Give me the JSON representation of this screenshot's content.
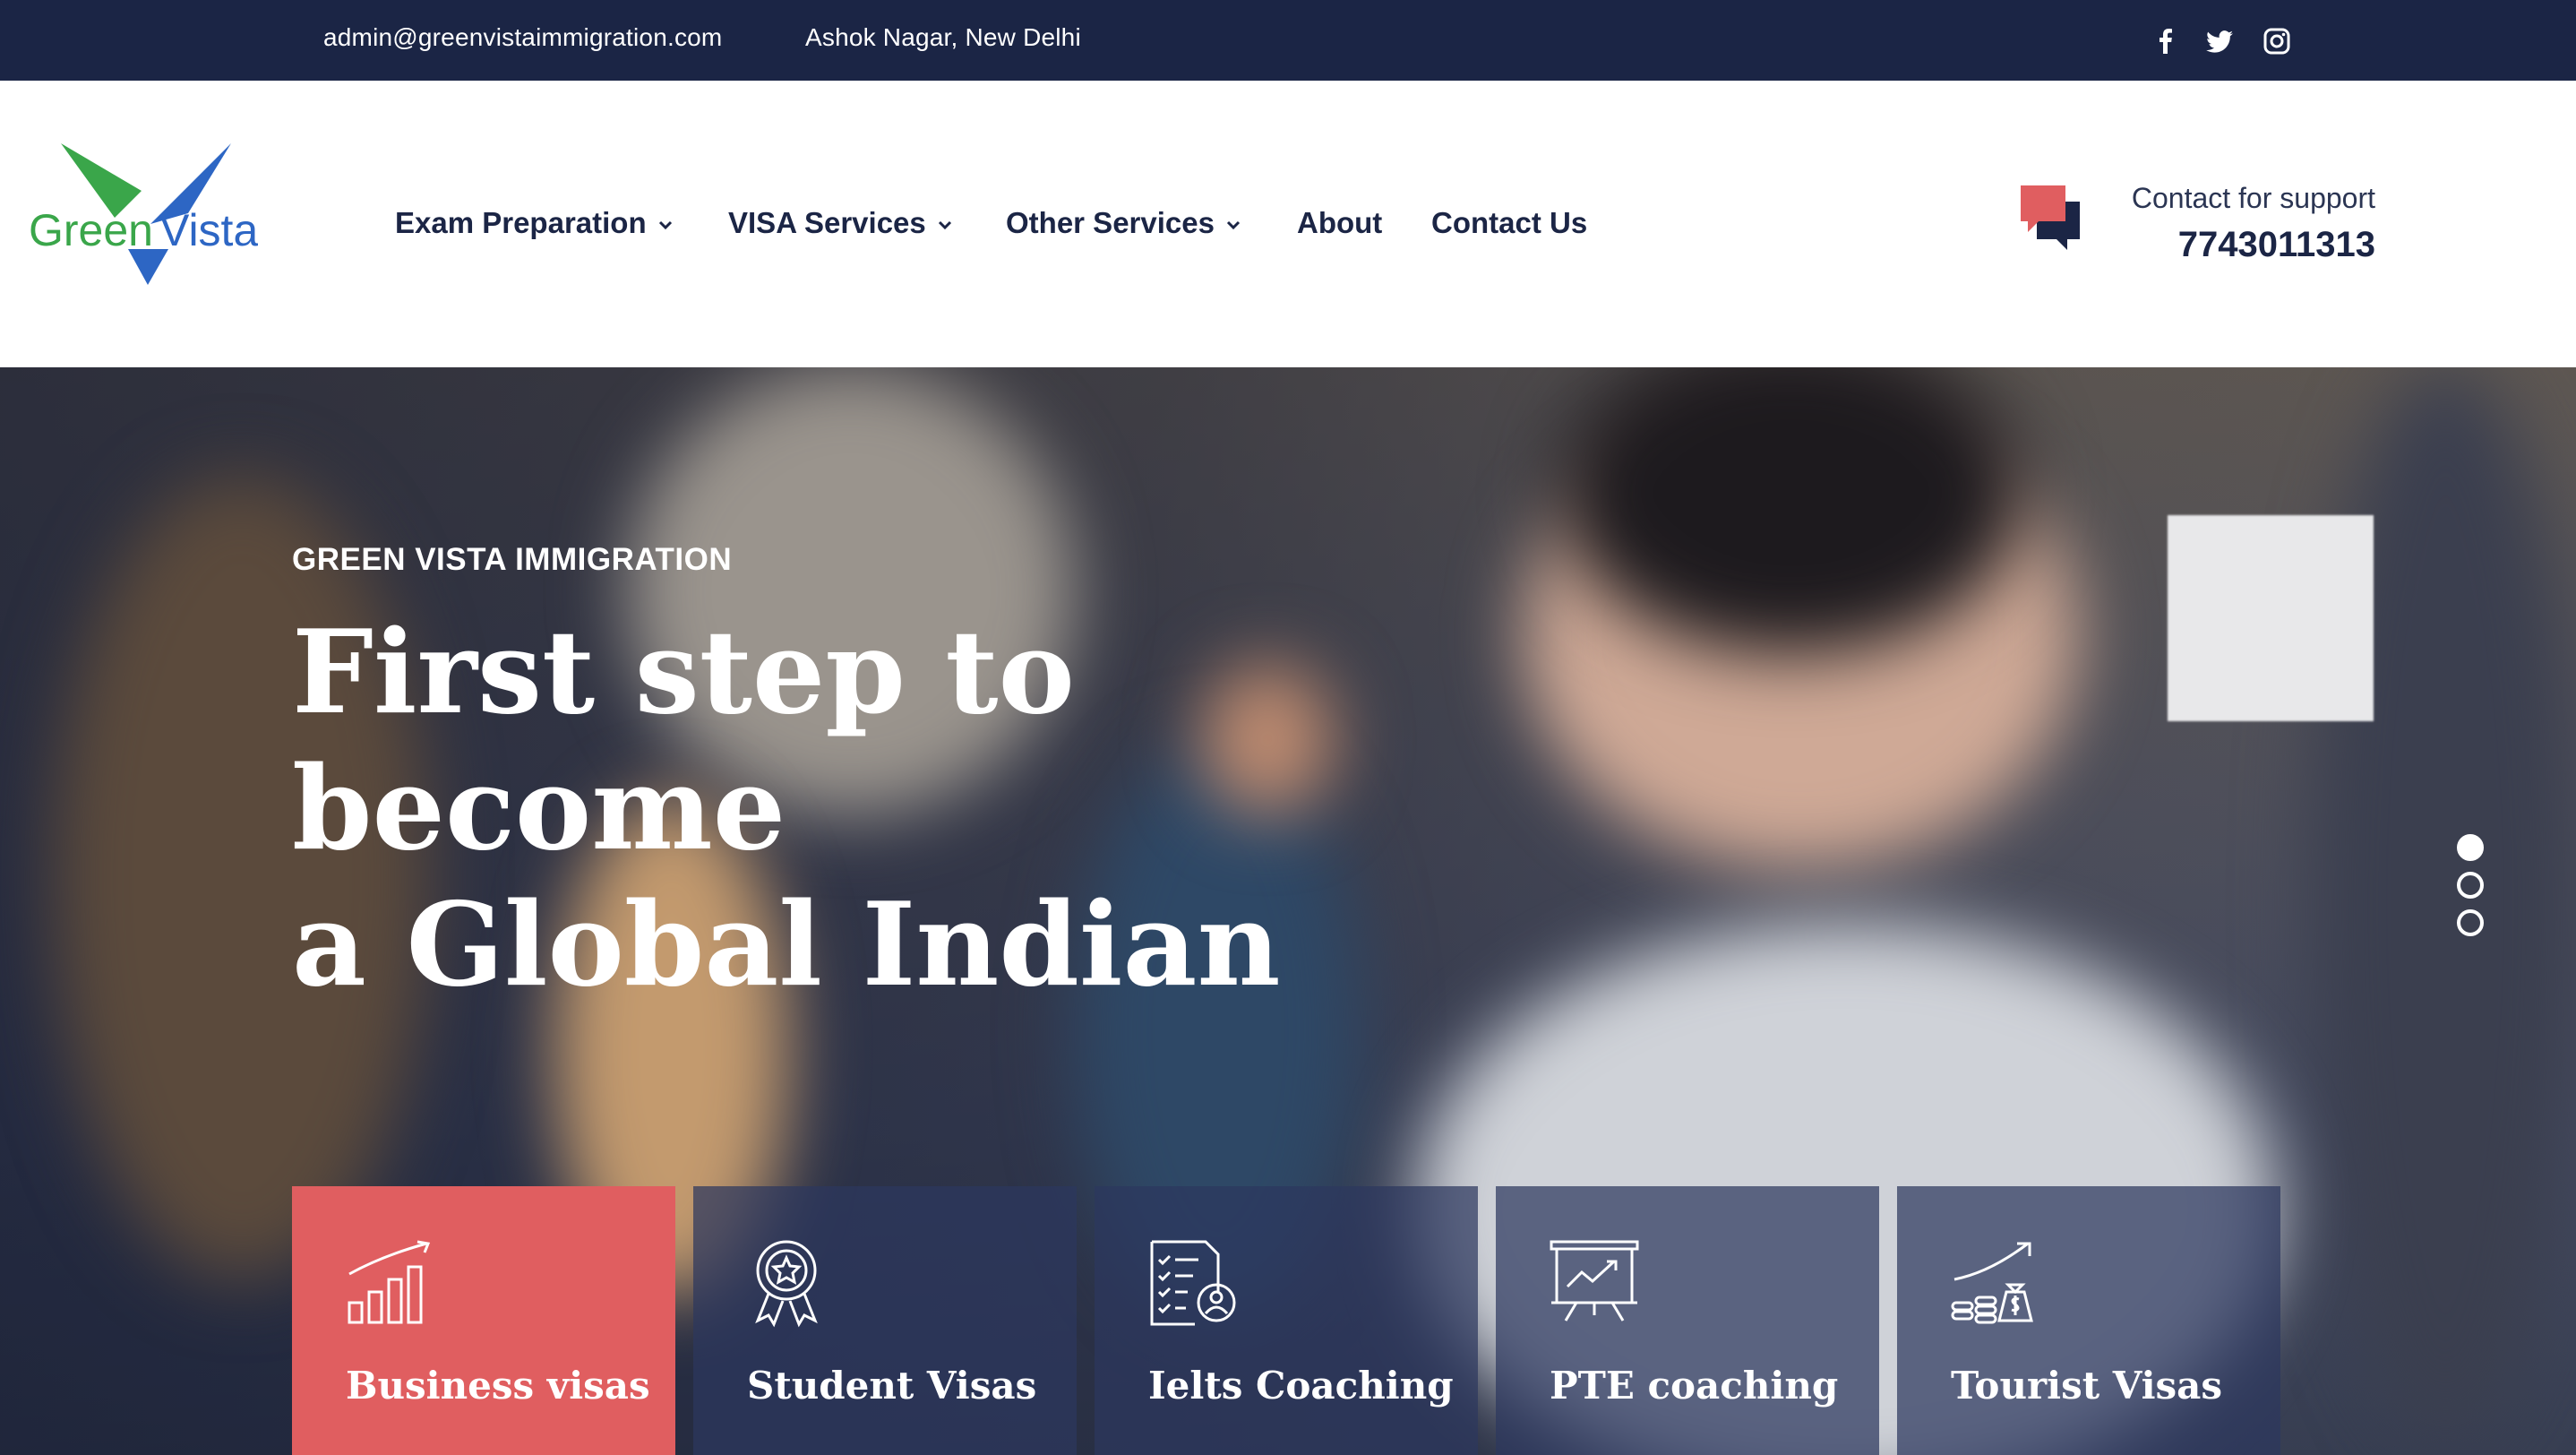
{
  "topbar": {
    "email": "admin@greenvistaimmigration.com",
    "address": "Ashok Nagar, New Delhi",
    "social": [
      "facebook-icon",
      "twitter-icon",
      "instagram-icon"
    ]
  },
  "logo": {
    "text_green": "Green",
    "text_blue": "Vista"
  },
  "nav": {
    "items": [
      {
        "label": "Exam Preparation",
        "dropdown": true
      },
      {
        "label": "VISA Services",
        "dropdown": true
      },
      {
        "label": "Other Services",
        "dropdown": true
      },
      {
        "label": "About",
        "dropdown": false
      },
      {
        "label": "Contact Us",
        "dropdown": false
      }
    ]
  },
  "support": {
    "label": "Contact for support",
    "phone": "7743011313"
  },
  "hero": {
    "kicker": "GREEN VISTA IMMIGRATION",
    "headline_line1": "First step to become",
    "headline_line2": "a Global Indian",
    "slides": 3,
    "active_slide": 1
  },
  "services": [
    {
      "label": "Business visas",
      "icon": "bar-chart-icon",
      "active": true
    },
    {
      "label": "Student Visas",
      "icon": "award-badge-icon",
      "active": false
    },
    {
      "label": "Ielts Coaching",
      "icon": "checklist-document-icon",
      "active": false
    },
    {
      "label": "PTE coaching",
      "icon": "presentation-board-icon",
      "active": false
    },
    {
      "label": "Tourist Visas",
      "icon": "money-growth-icon",
      "active": false
    }
  ],
  "colors": {
    "navy": "#1b2545",
    "accent_red": "#e05e60",
    "logo_green": "#3aa64a",
    "logo_blue": "#2d66c4"
  }
}
